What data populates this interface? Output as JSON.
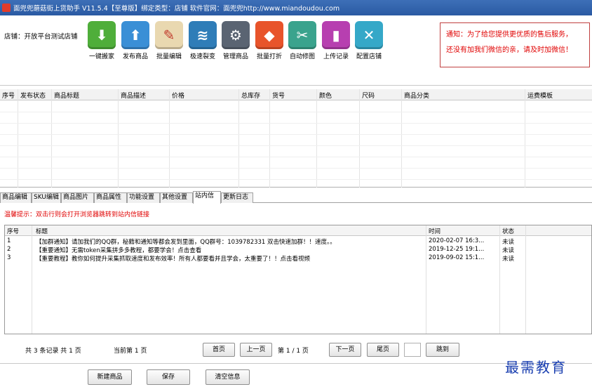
{
  "titlebar": {
    "title": "面兜兜蘑菇街上货助手 V11.5.4【至尊版】绑定类型：店铺 软件官网：面兜兜http://www.miandoudou.com"
  },
  "toolbar": {
    "store_label": "店铺：开放平台测试店铺",
    "tools": [
      {
        "label": "一键搬家",
        "icon": "download-arrow-icon",
        "color": "#4fae3a",
        "glyph": "⬇"
      },
      {
        "label": "发布商品",
        "icon": "upload-arrow-icon",
        "color": "#3a8fd6",
        "glyph": "⬆"
      },
      {
        "label": "批量编辑",
        "icon": "notepad-pencil-icon",
        "color": "#e9d8b0",
        "glyph": "✎"
      },
      {
        "label": "极速裂变",
        "icon": "layers-icon",
        "color": "#2f7db8",
        "glyph": "≋"
      },
      {
        "label": "管理商品",
        "icon": "gear-icon",
        "color": "#5a6472",
        "glyph": "⚙"
      },
      {
        "label": "批量打折",
        "icon": "price-tag-icon",
        "color": "#e8542b",
        "glyph": "✂"
      },
      {
        "label": "自动修图",
        "icon": "scissors-icon",
        "color": "#3aa38d",
        "glyph": "✂"
      },
      {
        "label": "上传记录",
        "icon": "bookmark-icon",
        "color": "#b73fb0",
        "glyph": "▮"
      },
      {
        "label": "配置店铺",
        "icon": "tools-icon",
        "color": "#35a8c8",
        "glyph": "✕"
      }
    ]
  },
  "notice": {
    "line1": "通知：为了给您提供更优质的售后服务，",
    "line2": "还没有加我们微信的亲，请及时加微信！"
  },
  "product_grid": {
    "columns": [
      "序号",
      "发布状态",
      "商品标题",
      "商品描述",
      "价格",
      "总库存",
      "货号",
      "颜色",
      "尺码",
      "商品分类",
      "运费模板"
    ]
  },
  "tabs": [
    "商品编辑",
    "SKU编辑",
    "商品图片",
    "商品属性",
    "功能设置",
    "其他设置",
    "站内信",
    "更新日志"
  ],
  "active_tab": "站内信",
  "tip": "温馨提示：双击行则会打开浏览器跳转到站内信链接",
  "messages": {
    "columns": [
      "序号",
      "标题",
      "时间",
      "状态"
    ],
    "rows": [
      {
        "no": "1",
        "title": "【加群通知】请加我们的QQ群，秘籍和通知等都会发到里面，QQ群号：1039782331 双击快速加群！！速度。。",
        "time": "2020-02-07 16:3...",
        "status": "未读"
      },
      {
        "no": "2",
        "title": "【重要通知】无需token采集拼多多教程，都要学会！点击查看",
        "time": "2019-12-25 19:1...",
        "status": "未读"
      },
      {
        "no": "3",
        "title": "【重要教程】教你如何提升采集抓取速度和发布效率！所有人都要看并且学会，太重要了！！点击看视频",
        "time": "2019-09-02 15:1...",
        "status": "未读"
      }
    ]
  },
  "pager": {
    "total": "共 3 条记录 共 1 页",
    "current": "当前第 1 页",
    "first": "首页",
    "prev": "上一页",
    "page_info": "第 1 / 1 页",
    "next": "下一页",
    "last": "尾页",
    "jump": "跳到"
  },
  "footer": {
    "new_product": "新建商品",
    "save": "保存",
    "clear": "清空信息"
  },
  "watermark": "最需教育"
}
